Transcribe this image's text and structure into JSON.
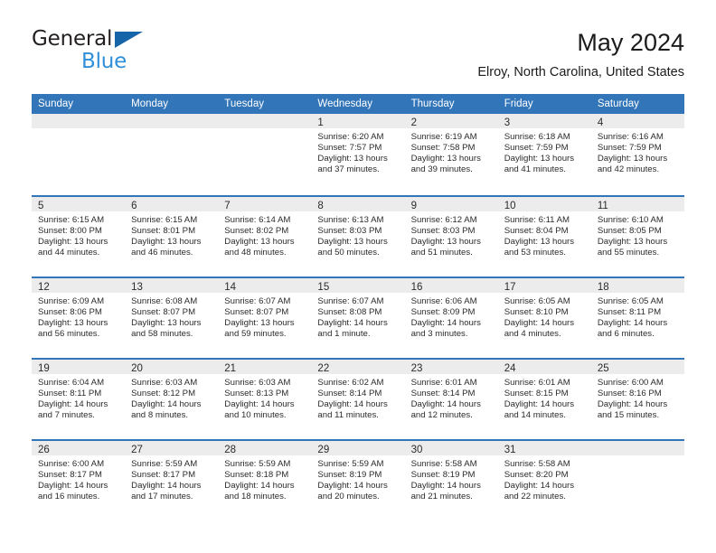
{
  "logo": {
    "word1": "General",
    "word2": "Blue",
    "triangle_color": "#1565a8",
    "word2_color": "#2f8fd8",
    "icon": "general-blue-logo"
  },
  "header": {
    "title": "May 2024",
    "subtitle": "Elroy, North Carolina, United States"
  },
  "theme": {
    "header_blue": "#3275b8",
    "daynum_band": "#ececec",
    "text": "#2b2b2b"
  },
  "calendar": {
    "day_names": [
      "Sunday",
      "Monday",
      "Tuesday",
      "Wednesday",
      "Thursday",
      "Friday",
      "Saturday"
    ],
    "weeks": [
      [
        {
          "day": "",
          "lines": []
        },
        {
          "day": "",
          "lines": []
        },
        {
          "day": "",
          "lines": []
        },
        {
          "day": "1",
          "lines": [
            "Sunrise: 6:20 AM",
            "Sunset: 7:57 PM",
            "Daylight: 13 hours",
            "and 37 minutes."
          ]
        },
        {
          "day": "2",
          "lines": [
            "Sunrise: 6:19 AM",
            "Sunset: 7:58 PM",
            "Daylight: 13 hours",
            "and 39 minutes."
          ]
        },
        {
          "day": "3",
          "lines": [
            "Sunrise: 6:18 AM",
            "Sunset: 7:59 PM",
            "Daylight: 13 hours",
            "and 41 minutes."
          ]
        },
        {
          "day": "4",
          "lines": [
            "Sunrise: 6:16 AM",
            "Sunset: 7:59 PM",
            "Daylight: 13 hours",
            "and 42 minutes."
          ]
        }
      ],
      [
        {
          "day": "5",
          "lines": [
            "Sunrise: 6:15 AM",
            "Sunset: 8:00 PM",
            "Daylight: 13 hours",
            "and 44 minutes."
          ]
        },
        {
          "day": "6",
          "lines": [
            "Sunrise: 6:15 AM",
            "Sunset: 8:01 PM",
            "Daylight: 13 hours",
            "and 46 minutes."
          ]
        },
        {
          "day": "7",
          "lines": [
            "Sunrise: 6:14 AM",
            "Sunset: 8:02 PM",
            "Daylight: 13 hours",
            "and 48 minutes."
          ]
        },
        {
          "day": "8",
          "lines": [
            "Sunrise: 6:13 AM",
            "Sunset: 8:03 PM",
            "Daylight: 13 hours",
            "and 50 minutes."
          ]
        },
        {
          "day": "9",
          "lines": [
            "Sunrise: 6:12 AM",
            "Sunset: 8:03 PM",
            "Daylight: 13 hours",
            "and 51 minutes."
          ]
        },
        {
          "day": "10",
          "lines": [
            "Sunrise: 6:11 AM",
            "Sunset: 8:04 PM",
            "Daylight: 13 hours",
            "and 53 minutes."
          ]
        },
        {
          "day": "11",
          "lines": [
            "Sunrise: 6:10 AM",
            "Sunset: 8:05 PM",
            "Daylight: 13 hours",
            "and 55 minutes."
          ]
        }
      ],
      [
        {
          "day": "12",
          "lines": [
            "Sunrise: 6:09 AM",
            "Sunset: 8:06 PM",
            "Daylight: 13 hours",
            "and 56 minutes."
          ]
        },
        {
          "day": "13",
          "lines": [
            "Sunrise: 6:08 AM",
            "Sunset: 8:07 PM",
            "Daylight: 13 hours",
            "and 58 minutes."
          ]
        },
        {
          "day": "14",
          "lines": [
            "Sunrise: 6:07 AM",
            "Sunset: 8:07 PM",
            "Daylight: 13 hours",
            "and 59 minutes."
          ]
        },
        {
          "day": "15",
          "lines": [
            "Sunrise: 6:07 AM",
            "Sunset: 8:08 PM",
            "Daylight: 14 hours",
            "and 1 minute."
          ]
        },
        {
          "day": "16",
          "lines": [
            "Sunrise: 6:06 AM",
            "Sunset: 8:09 PM",
            "Daylight: 14 hours",
            "and 3 minutes."
          ]
        },
        {
          "day": "17",
          "lines": [
            "Sunrise: 6:05 AM",
            "Sunset: 8:10 PM",
            "Daylight: 14 hours",
            "and 4 minutes."
          ]
        },
        {
          "day": "18",
          "lines": [
            "Sunrise: 6:05 AM",
            "Sunset: 8:11 PM",
            "Daylight: 14 hours",
            "and 6 minutes."
          ]
        }
      ],
      [
        {
          "day": "19",
          "lines": [
            "Sunrise: 6:04 AM",
            "Sunset: 8:11 PM",
            "Daylight: 14 hours",
            "and 7 minutes."
          ]
        },
        {
          "day": "20",
          "lines": [
            "Sunrise: 6:03 AM",
            "Sunset: 8:12 PM",
            "Daylight: 14 hours",
            "and 8 minutes."
          ]
        },
        {
          "day": "21",
          "lines": [
            "Sunrise: 6:03 AM",
            "Sunset: 8:13 PM",
            "Daylight: 14 hours",
            "and 10 minutes."
          ]
        },
        {
          "day": "22",
          "lines": [
            "Sunrise: 6:02 AM",
            "Sunset: 8:14 PM",
            "Daylight: 14 hours",
            "and 11 minutes."
          ]
        },
        {
          "day": "23",
          "lines": [
            "Sunrise: 6:01 AM",
            "Sunset: 8:14 PM",
            "Daylight: 14 hours",
            "and 12 minutes."
          ]
        },
        {
          "day": "24",
          "lines": [
            "Sunrise: 6:01 AM",
            "Sunset: 8:15 PM",
            "Daylight: 14 hours",
            "and 14 minutes."
          ]
        },
        {
          "day": "25",
          "lines": [
            "Sunrise: 6:00 AM",
            "Sunset: 8:16 PM",
            "Daylight: 14 hours",
            "and 15 minutes."
          ]
        }
      ],
      [
        {
          "day": "26",
          "lines": [
            "Sunrise: 6:00 AM",
            "Sunset: 8:17 PM",
            "Daylight: 14 hours",
            "and 16 minutes."
          ]
        },
        {
          "day": "27",
          "lines": [
            "Sunrise: 5:59 AM",
            "Sunset: 8:17 PM",
            "Daylight: 14 hours",
            "and 17 minutes."
          ]
        },
        {
          "day": "28",
          "lines": [
            "Sunrise: 5:59 AM",
            "Sunset: 8:18 PM",
            "Daylight: 14 hours",
            "and 18 minutes."
          ]
        },
        {
          "day": "29",
          "lines": [
            "Sunrise: 5:59 AM",
            "Sunset: 8:19 PM",
            "Daylight: 14 hours",
            "and 20 minutes."
          ]
        },
        {
          "day": "30",
          "lines": [
            "Sunrise: 5:58 AM",
            "Sunset: 8:19 PM",
            "Daylight: 14 hours",
            "and 21 minutes."
          ]
        },
        {
          "day": "31",
          "lines": [
            "Sunrise: 5:58 AM",
            "Sunset: 8:20 PM",
            "Daylight: 14 hours",
            "and 22 minutes."
          ]
        },
        {
          "day": "",
          "lines": []
        }
      ]
    ]
  }
}
